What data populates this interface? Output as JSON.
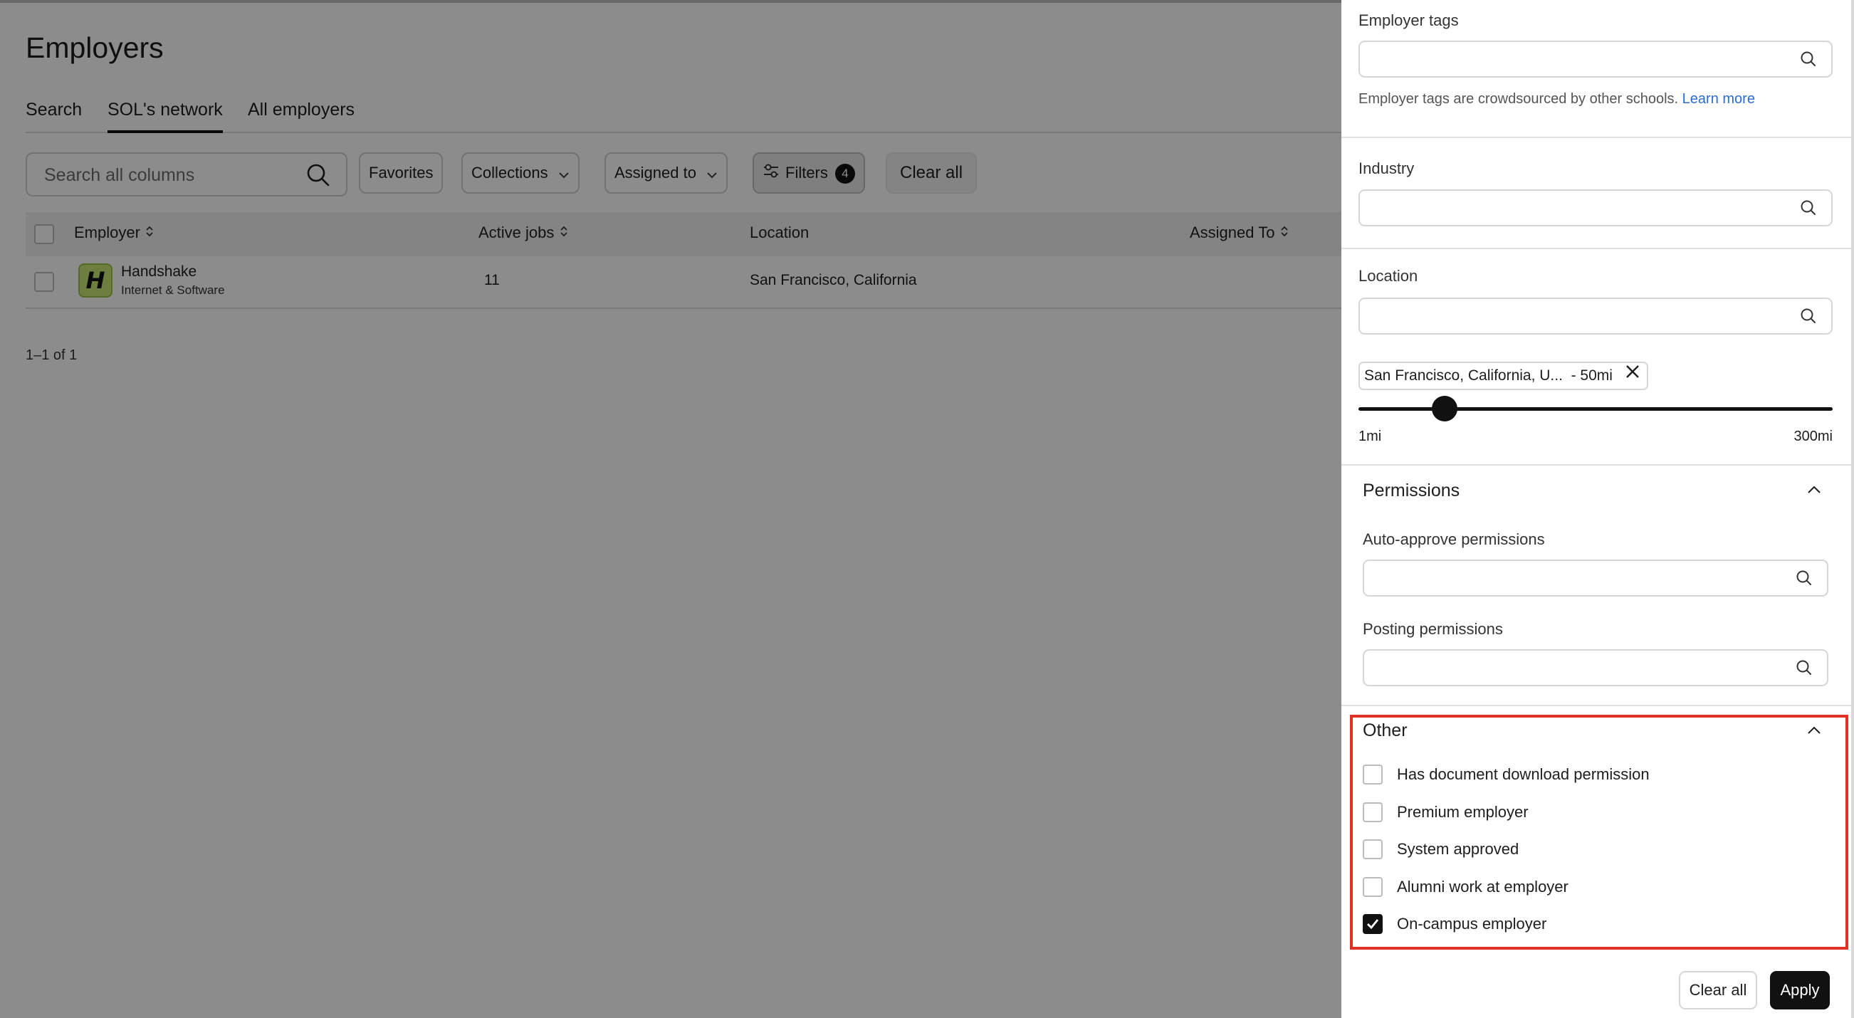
{
  "page": {
    "title": "Employers",
    "tabs": [
      {
        "label": "Search"
      },
      {
        "label": "SOL's network"
      },
      {
        "label": "All employers"
      }
    ]
  },
  "toolbar": {
    "search_placeholder": "Search all columns",
    "favorites": "Favorites",
    "collections": "Collections",
    "assigned_to": "Assigned to",
    "filters": "Filters",
    "filters_count": "4",
    "clear_all": "Clear all"
  },
  "table": {
    "columns": {
      "employer": "Employer",
      "active_jobs": "Active jobs",
      "location": "Location",
      "assigned_to": "Assigned To"
    },
    "rows": [
      {
        "logo_letter": "H",
        "name": "Handshake",
        "category": "Internet & Software",
        "active_jobs": "11",
        "location": "San Francisco, California",
        "assigned_to": ""
      }
    ],
    "pagination": "1–1 of 1"
  },
  "drawer": {
    "employer_tags": {
      "label": "Employer tags",
      "help_text": "Employer tags are crowdsourced by other schools.",
      "learn_more": "Learn more"
    },
    "industry": {
      "label": "Industry"
    },
    "location": {
      "label": "Location",
      "chip_text": "San Francisco, California, U...",
      "chip_radius": "- 50mi",
      "range_min": "1mi",
      "range_max": "300mi",
      "radius_value_mi": 50
    },
    "permissions": {
      "title": "Permissions",
      "auto_approve_label": "Auto-approve permissions",
      "posting_label": "Posting permissions"
    },
    "other": {
      "title": "Other",
      "options": [
        {
          "label": "Has document download permission",
          "checked": false
        },
        {
          "label": "Premium employer",
          "checked": false
        },
        {
          "label": "System approved",
          "checked": false
        },
        {
          "label": "Alumni work at employer",
          "checked": false
        },
        {
          "label": "On-campus employer",
          "checked": true
        }
      ]
    },
    "footer": {
      "clear_all": "Clear all",
      "apply": "Apply"
    }
  },
  "colors": {
    "highlight": "#e03127",
    "link": "#2a6bd6",
    "logo_bg": "#c6e573",
    "primary": "#111111"
  }
}
